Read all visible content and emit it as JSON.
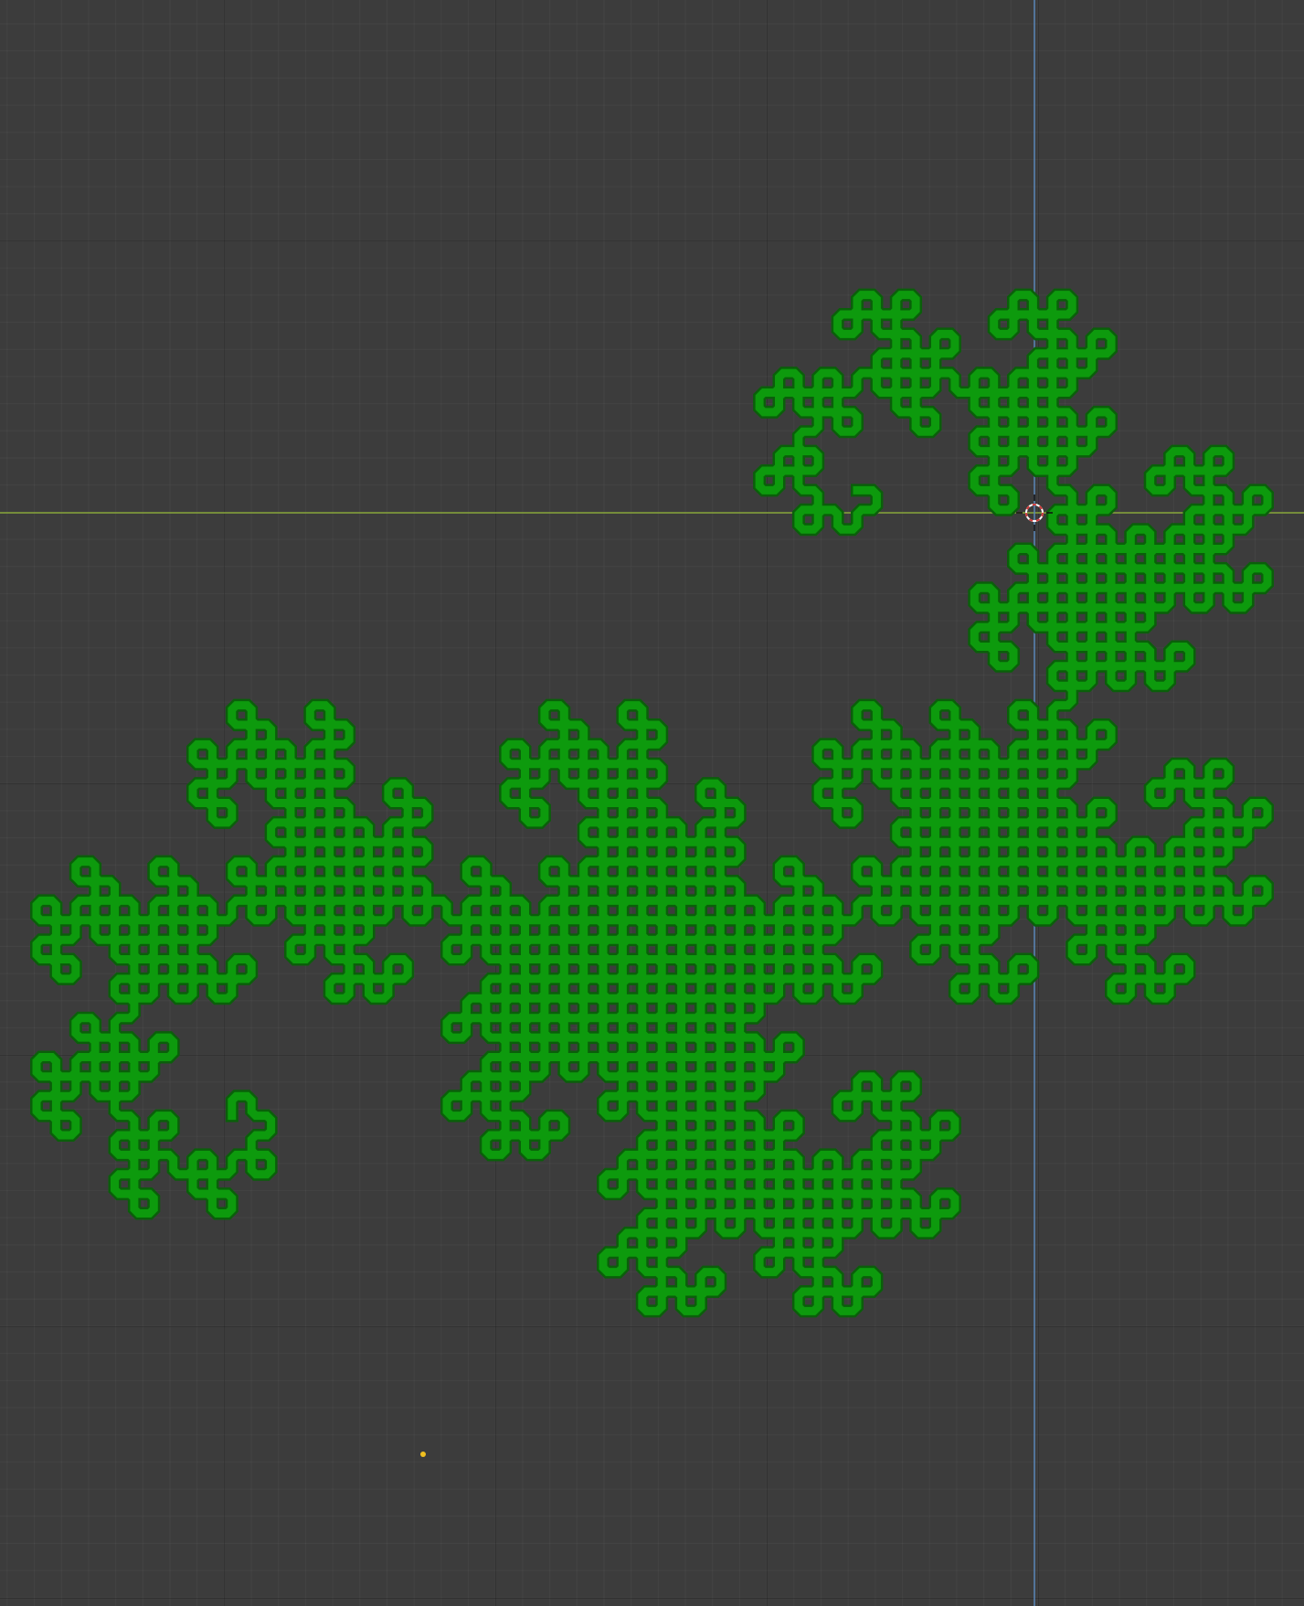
{
  "viewport": {
    "kind": "3d-viewport-top-orthographic",
    "grid": true,
    "background_color": "#3c3c3c",
    "grid_major_color": "#2f2f2f",
    "grid_minor_color": "#434343"
  },
  "axes": {
    "x_axis_color": "#8aa83c",
    "y_axis_color": "#5a86b8"
  },
  "object": {
    "type": "dragon-curve-tube",
    "iterations": 11,
    "color": "#0d9a0d",
    "outline_color": "#0a5f0a",
    "selected": false
  },
  "cursor_3d": {
    "icon": "3d-cursor-icon",
    "color_ring_a": "#ffffff",
    "color_ring_b": "#d23a3a"
  },
  "origin_point": {
    "icon": "origin-dot-icon",
    "color": "#f0c020"
  }
}
